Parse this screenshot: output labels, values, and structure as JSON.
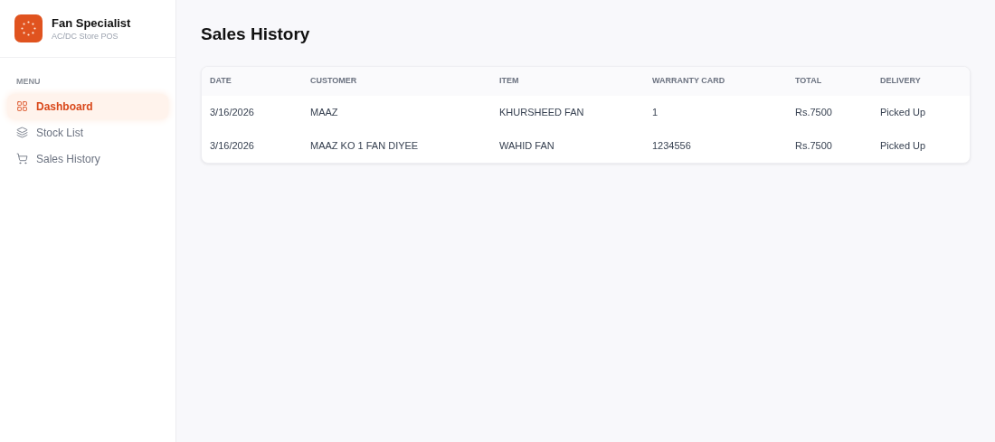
{
  "brand": {
    "title": "Fan Specialist",
    "subtitle": "AC/DC Store POS"
  },
  "sidebar": {
    "heading": "MENU",
    "items": [
      {
        "label": "Dashboard",
        "kind": "dashboard",
        "selected": true
      },
      {
        "label": "Stock List",
        "kind": "stock",
        "selected": false
      },
      {
        "label": "Sales History",
        "kind": "sales",
        "selected": false
      }
    ]
  },
  "page": {
    "title": "Sales History"
  },
  "table": {
    "columns": [
      "DATE",
      "CUSTOMER",
      "ITEM",
      "WARRANTY CARD",
      "TOTAL",
      "DELIVERY"
    ],
    "rows": [
      [
        "3/16/2026",
        "MAAZ",
        "KHURSHEED FAN",
        "1",
        "Rs.7500",
        "Picked Up"
      ],
      [
        "3/16/2026",
        "MAAZ KO 1 FAN DIYEE",
        "WAHID FAN",
        "1234556",
        "Rs.7500",
        "Picked Up"
      ]
    ]
  }
}
